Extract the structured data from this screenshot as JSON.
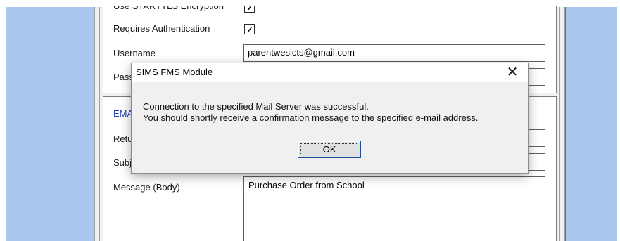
{
  "settings": {
    "starttls_label": "Use STARTTLS Encryption",
    "requires_auth_label": "Requires Authentication",
    "requires_auth_checked": "🗸",
    "starttls_checked": "🗸",
    "username_label": "Username",
    "username_value": "parentwesicts@gmail.com",
    "password_label": "Password"
  },
  "email": {
    "section_label": "EMAIL DETAILS",
    "return_label": "Return Address",
    "subject_label": "Subject",
    "message_label": "Message (Body)",
    "message_value": "Purchase Order from School"
  },
  "dialog": {
    "title": "SIMS FMS Module",
    "close_glyph": "✕",
    "line1": "Connection to the specified Mail Server was successful.",
    "line2": "You should shortly receive a confirmation message to the specified e-mail address.",
    "ok_label": "OK"
  },
  "colors": {
    "desktop": "#a9c7ee",
    "section_heading": "#1f3fb5",
    "dialog_focus_border": "#1e4f9c"
  }
}
